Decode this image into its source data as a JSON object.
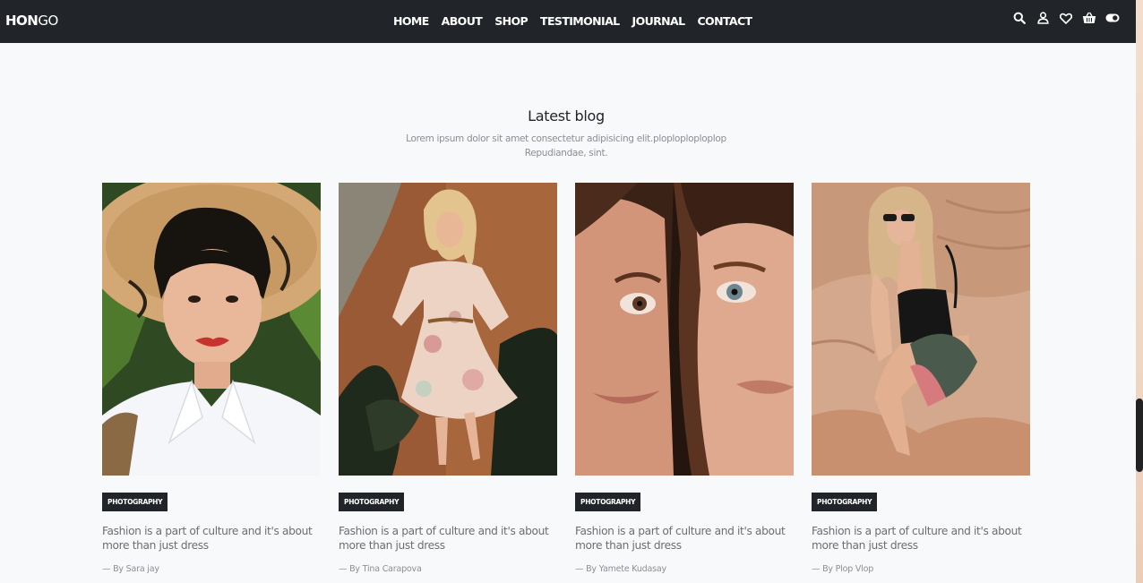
{
  "brand": {
    "bold": "HON",
    "light": "GO"
  },
  "nav": {
    "items": [
      "HOME",
      "ABOUT",
      "SHOP",
      "TESTIMONIAL",
      "JOURNAL",
      "CONTACT"
    ]
  },
  "icons": [
    "search-icon",
    "user-icon",
    "heart-icon",
    "basket-icon",
    "toggle-icon"
  ],
  "section": {
    "title": "Latest blog",
    "subtitle_line1": "Lorem ipsum dolor sit amet consectetur adipisicing elit.ploploploploplop",
    "subtitle_line2": "Repudiandae, sint."
  },
  "posts": [
    {
      "tag": "PHOTOGRAPHY",
      "title_line1": "Fashion is a part of culture and it's about",
      "title_line2": "more than just dress",
      "author": "— By Sara jay"
    },
    {
      "tag": "PHOTOGRAPHY",
      "title_line1": "Fashion is a part of culture and it's about",
      "title_line2": "more than just dress",
      "author": "— By Tina Carapova"
    },
    {
      "tag": "PHOTOGRAPHY",
      "title_line1": "Fashion is a part of culture and it's about",
      "title_line2": "more than just dress",
      "author": "— By Yamete Kudasay"
    },
    {
      "tag": "PHOTOGRAPHY",
      "title_line1": "Fashion is a part of culture and it's about",
      "title_line2": "more than just dress",
      "author": "— By Plop Vlop"
    }
  ],
  "colors": {
    "navbar": "#212529",
    "background": "#f7f9fb",
    "tag_bg": "#212529",
    "text_muted": "#6b6f74"
  }
}
